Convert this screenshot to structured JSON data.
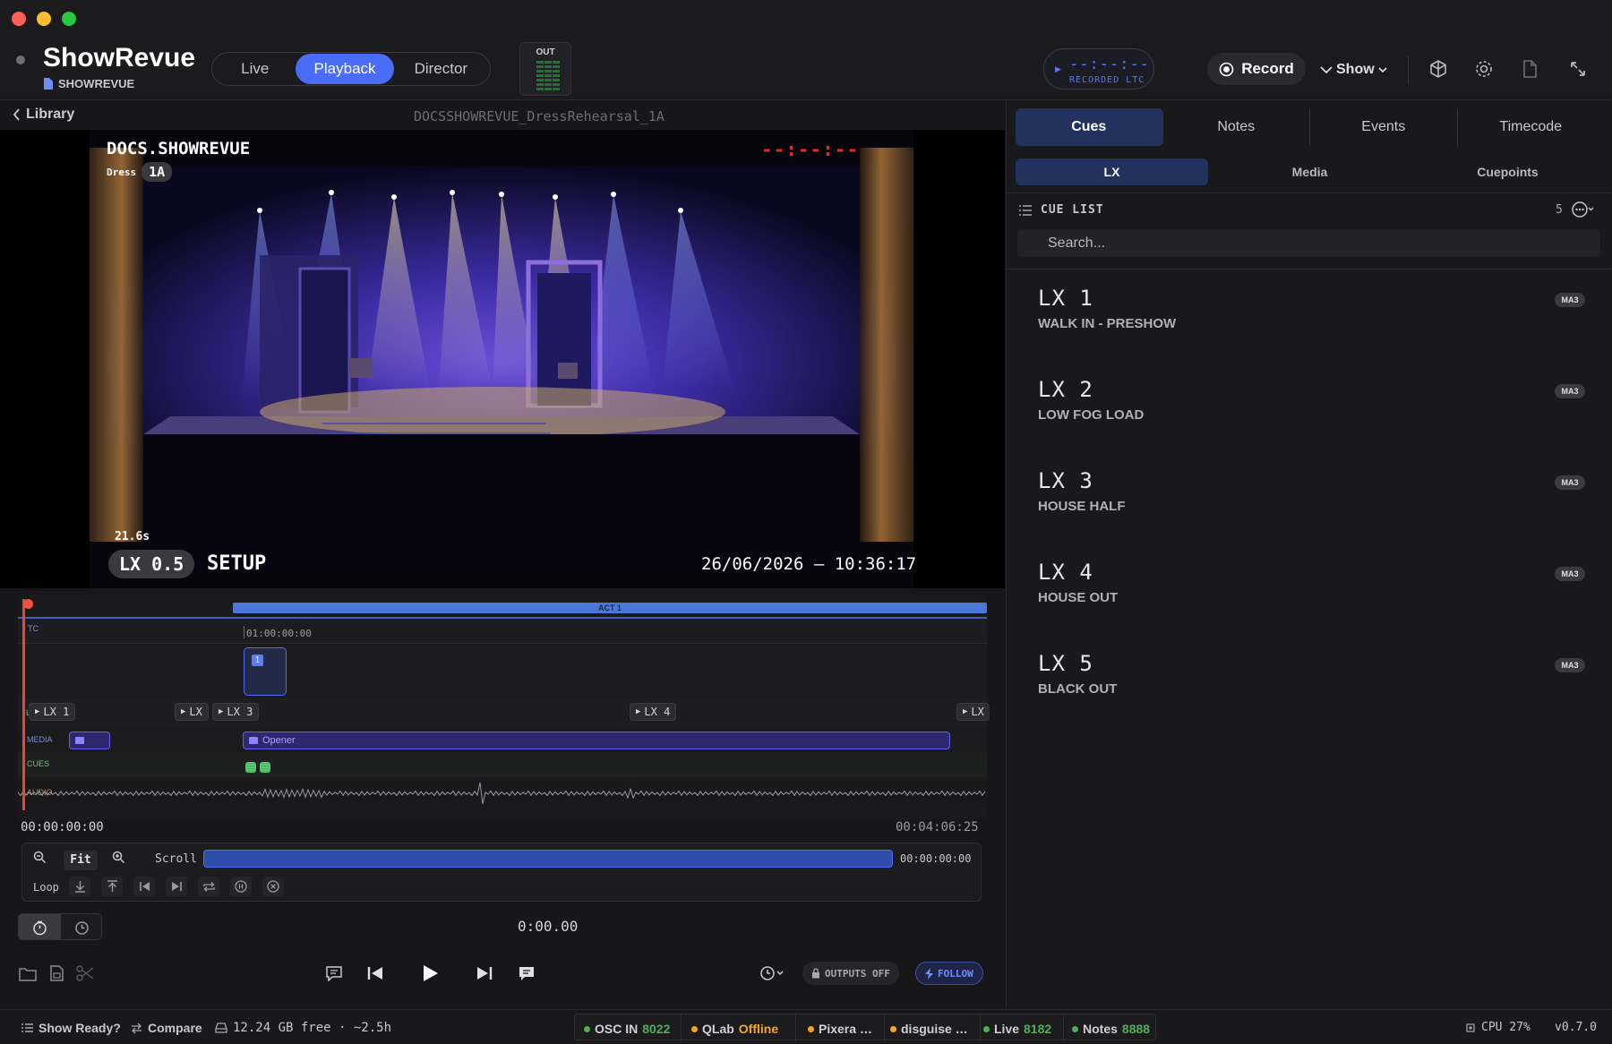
{
  "window": {
    "traffic_lights": [
      "#ff5f57",
      "#febc2e",
      "#28c840"
    ]
  },
  "header": {
    "title": "ShowRevue",
    "subtitle": "SHOWREVUE",
    "modes": [
      {
        "label": "Live",
        "active": false
      },
      {
        "label": "Playback",
        "active": true
      },
      {
        "label": "Director",
        "active": false
      }
    ],
    "out_meter_label": "OUT",
    "ltc": {
      "value": "--:--:--",
      "label": "RECORDED LTC"
    },
    "record_label": "Record",
    "show_label": "Show",
    "icons": [
      "cube-icon",
      "gear-icon",
      "document-icon",
      "expand-icon"
    ]
  },
  "library": {
    "back_label": "Library",
    "file_name": "DOCSSHOWREVUE_DressRehearsal_1A"
  },
  "overlay": {
    "title": "DOCS.SHOWREVUE",
    "dress": "Dress",
    "scene": "1A",
    "timecode": "--:--:--",
    "elapsed": "21.6s",
    "cue_pill": "LX 0.5",
    "cue_name": "SETUP",
    "datetime": "26/06/2026 – 10:36:17"
  },
  "timeline": {
    "act_label": "ACT 1",
    "track_tc": "TC",
    "tc_mark": "01:00:00:00",
    "marker_number": "1",
    "track_lx": "LX",
    "lx_chips": [
      "LX 1",
      "LX",
      "LX 3",
      "LX 4",
      "LX"
    ],
    "track_media": "MEDIA",
    "media_clip": "Opener",
    "track_cues": "CUES",
    "track_audio": "AUDIO",
    "start": "00:00:00:00",
    "end": "00:04:06:25"
  },
  "controls": {
    "fit_label": "Fit",
    "scroll_label": "Scroll",
    "scroll_tc": "00:00:00:00",
    "loop_label": "Loop",
    "clock": "0:00.00"
  },
  "transport": {
    "outputs_label": "OUTPUTS OFF",
    "follow_label": "FOLLOW"
  },
  "right": {
    "tabs": [
      {
        "label": "Cues",
        "active": true
      },
      {
        "label": "Notes",
        "active": false
      },
      {
        "label": "Events",
        "active": false
      },
      {
        "label": "Timecode",
        "active": false
      }
    ],
    "sub_tabs": [
      {
        "label": "LX",
        "active": true
      },
      {
        "label": "Media",
        "active": false
      },
      {
        "label": "Cuepoints",
        "active": false
      }
    ],
    "cue_list_label": "CUE LIST",
    "cue_count": "5",
    "search_placeholder": "Search...",
    "cues": [
      {
        "number": "LX 1",
        "name": "WALK IN - PRESHOW",
        "badge": "MA3"
      },
      {
        "number": "LX 2",
        "name": "LOW FOG LOAD",
        "badge": "MA3"
      },
      {
        "number": "LX 3",
        "name": "HOUSE HALF",
        "badge": "MA3"
      },
      {
        "number": "LX 4",
        "name": "HOUSE OUT",
        "badge": "MA3"
      },
      {
        "number": "LX 5",
        "name": "BLACK OUT",
        "badge": "MA3"
      }
    ]
  },
  "status": {
    "show_ready": "Show Ready?",
    "compare": "Compare",
    "disk": "12.24 GB free · ~2.5h",
    "services": [
      {
        "label": "OSC IN",
        "value": "8022",
        "color": "#4caf50"
      },
      {
        "label": "QLab",
        "value": "Offline",
        "color": "#f5a623"
      },
      {
        "label": "Pixera …",
        "value": "",
        "color": "#f5a623"
      },
      {
        "label": "disguise …",
        "value": "",
        "color": "#f5a623"
      },
      {
        "label": "Live",
        "value": "8182",
        "color": "#4caf50"
      },
      {
        "label": "Notes",
        "value": "8888",
        "color": "#4caf50"
      }
    ],
    "cpu": "CPU 27%",
    "version": "v0.7.0"
  }
}
